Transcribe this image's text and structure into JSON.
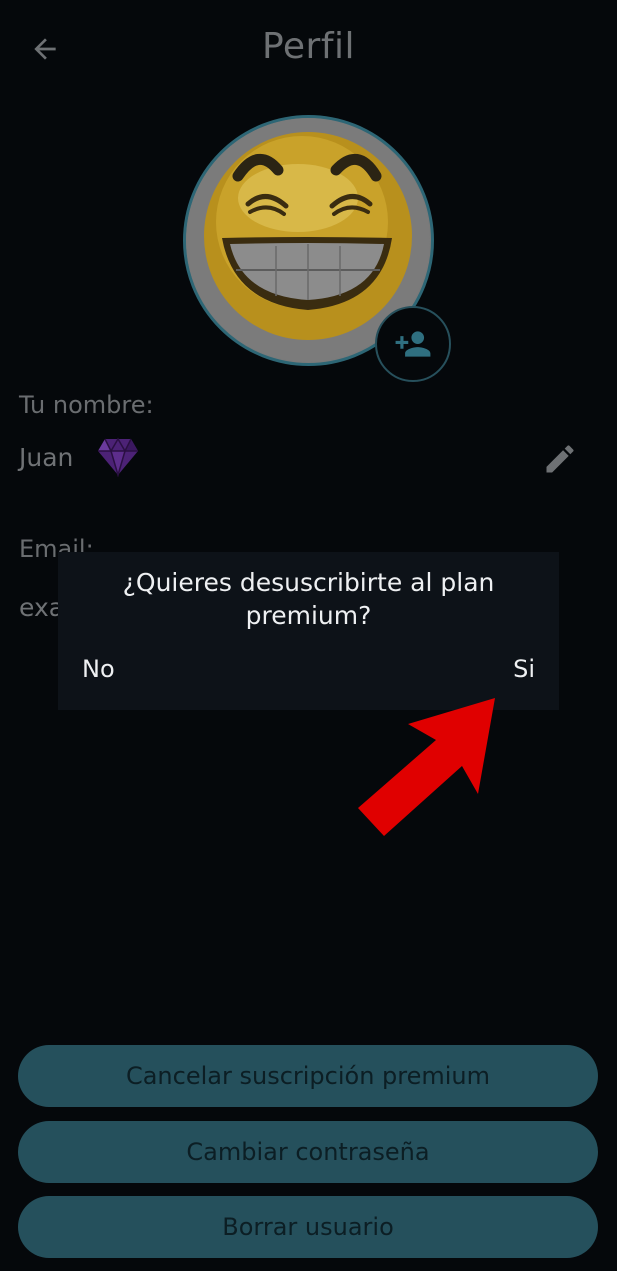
{
  "header": {
    "title": "Perfil"
  },
  "profile": {
    "name_label": "Tu nombre:",
    "name_value": "Juan",
    "email_label": "Email:",
    "email_value_partial": "exa"
  },
  "dialog": {
    "message": "¿Quieres desuscribirte al plan premium?",
    "no_label": "No",
    "yes_label": "Si"
  },
  "actions": {
    "cancel_premium": "Cancelar suscripción premium",
    "change_password": "Cambiar contraseña",
    "delete_user": "Borrar usuario"
  },
  "icons": {
    "back": "arrow-left-icon",
    "add_photo": "add-person-icon",
    "premium": "diamond-icon",
    "edit": "pencil-icon"
  },
  "colors": {
    "background": "#05080b",
    "dialog": "#0d1218",
    "button": "#25505c",
    "premium_gem": "#5b2a8f",
    "arrow": "#e00000"
  }
}
